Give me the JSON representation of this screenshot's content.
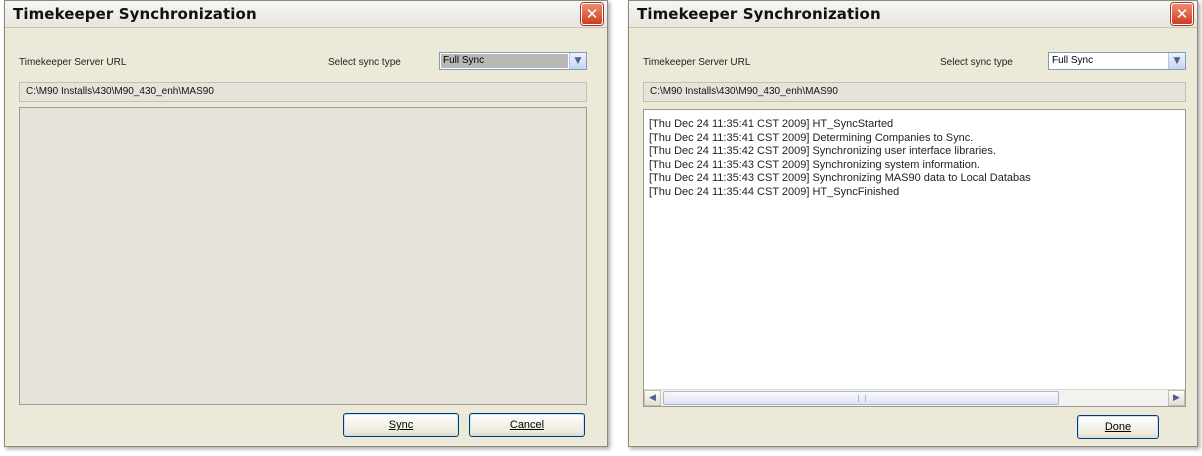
{
  "left_dialog": {
    "title": "Timekeeper Synchronization",
    "close_label": "✕",
    "server_url_label": "Timekeeper Server URL",
    "sync_type_label": "Select sync type",
    "sync_type_value": "Full Sync",
    "path": "C:\\M90 Installs\\430\\M90_430_enh\\MAS90",
    "sync_button": "Sync",
    "cancel_button": "Cancel"
  },
  "right_dialog": {
    "title": "Timekeeper Synchronization",
    "close_label": "✕",
    "server_url_label": "Timekeeper Server URL",
    "sync_type_label": "Select sync type",
    "sync_type_value": "Full Sync",
    "path": "C:\\M90 Installs\\430\\M90_430_enh\\MAS90",
    "log_lines": [
      "[Thu Dec 24 11:35:41 CST 2009] HT_SyncStarted",
      "[Thu Dec 24 11:35:41 CST 2009] Determining Companies to Sync.",
      "[Thu Dec 24 11:35:42 CST 2009] Synchronizing user interface libraries.",
      "[Thu Dec 24 11:35:43 CST 2009] Synchronizing system information.",
      "[Thu Dec 24 11:35:43 CST 2009] Synchronizing MAS90 data to Local Databas",
      "[Thu Dec 24 11:35:44 CST 2009] HT_SyncFinished"
    ],
    "done_button": "Done"
  },
  "icons": {
    "close": "close-icon",
    "dropdown": "chevron-down-icon",
    "scroll_left": "arrow-left-icon",
    "scroll_right": "arrow-right-icon"
  },
  "colors": {
    "dialog_bg": "#ece9d8",
    "close_red": "#cc3f21",
    "button_border": "#003c74",
    "log_bg": "#ffffff"
  }
}
